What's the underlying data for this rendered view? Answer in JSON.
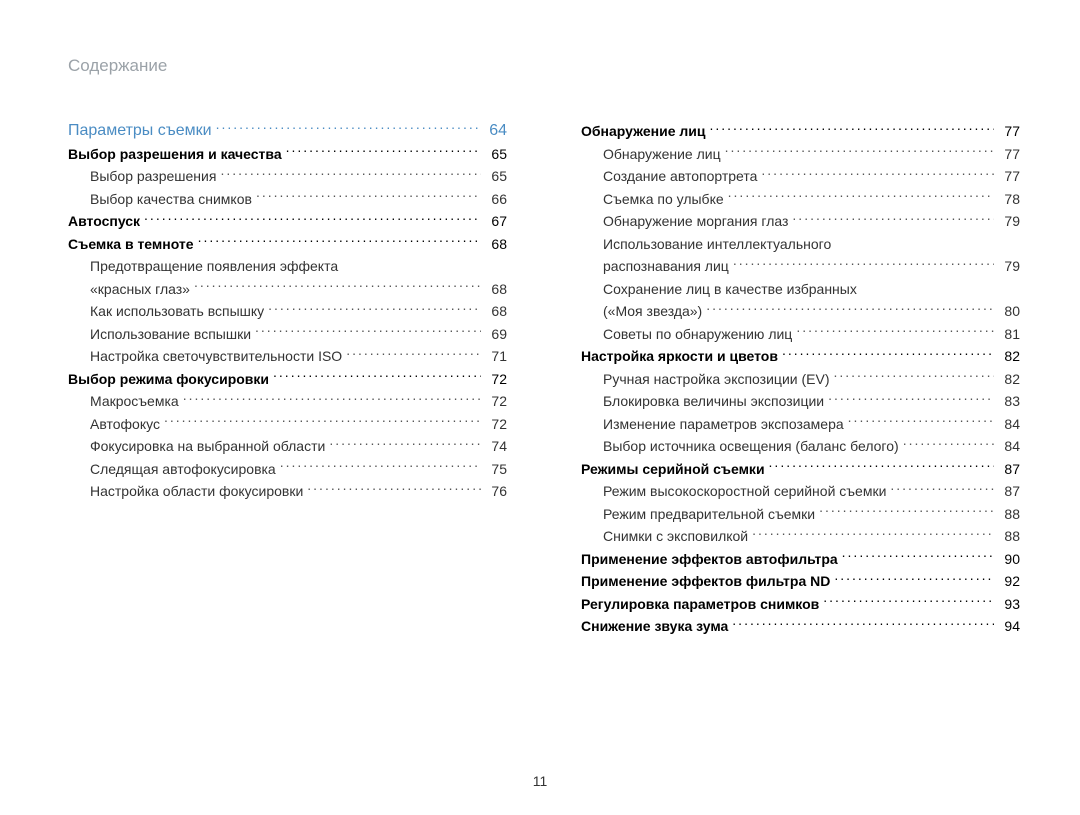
{
  "header": "Содержание",
  "page_number": "11",
  "left_col": [
    {
      "type": "chapter",
      "label": "Параметры съемки",
      "page": "64"
    },
    {
      "type": "section",
      "label": "Выбор разрешения и качества",
      "page": "65"
    },
    {
      "type": "item",
      "label": "Выбор разрешения",
      "page": "65"
    },
    {
      "type": "item",
      "label": "Выбор качества снимков",
      "page": "66"
    },
    {
      "type": "section",
      "label": "Автоспуск",
      "page": "67"
    },
    {
      "type": "section",
      "label": "Съемка в темноте",
      "page": "68"
    },
    {
      "type": "item-noline",
      "label": "Предотвращение появления эффекта"
    },
    {
      "type": "item-continue",
      "label": "«красных глаз»",
      "page": "68"
    },
    {
      "type": "item",
      "label": "Как использовать вспышку",
      "page": "68"
    },
    {
      "type": "item",
      "label": "Использование вспышки",
      "page": "69"
    },
    {
      "type": "item",
      "label": "Настройка светочувствительности ISO",
      "page": "71"
    },
    {
      "type": "section",
      "label": "Выбор режима фокусировки",
      "page": "72"
    },
    {
      "type": "item",
      "label": "Макросъемка",
      "page": "72"
    },
    {
      "type": "item",
      "label": "Автофокус",
      "page": "72"
    },
    {
      "type": "item",
      "label": "Фокусировка на выбранной области",
      "page": "74"
    },
    {
      "type": "item",
      "label": "Следящая автофокусировка",
      "page": "75"
    },
    {
      "type": "item",
      "label": "Настройка области фокусировки",
      "page": "76"
    }
  ],
  "right_col": [
    {
      "type": "section",
      "label": "Обнаружение лиц",
      "page": "77"
    },
    {
      "type": "item",
      "label": "Обнаружение лиц",
      "page": "77"
    },
    {
      "type": "item",
      "label": "Создание автопортрета",
      "page": "77"
    },
    {
      "type": "item",
      "label": "Съемка по улыбке",
      "page": "78"
    },
    {
      "type": "item",
      "label": "Обнаружение моргания глаз",
      "page": "79"
    },
    {
      "type": "item-noline",
      "label": "Использование интеллектуального"
    },
    {
      "type": "item-continue",
      "label": "распознавания лиц",
      "page": "79"
    },
    {
      "type": "item-noline",
      "label": "Сохранение лиц в качестве избранных"
    },
    {
      "type": "item-continue",
      "label": "(«Моя звезда»)",
      "page": "80"
    },
    {
      "type": "item",
      "label": "Советы по обнаружению лиц",
      "page": "81"
    },
    {
      "type": "section",
      "label": "Настройка яркости и цветов",
      "page": "82"
    },
    {
      "type": "item",
      "label": "Ручная настройка экспозиции (EV)",
      "page": "82"
    },
    {
      "type": "item",
      "label": "Блокировка величины экспозиции",
      "page": "83"
    },
    {
      "type": "item",
      "label": "Изменение параметров экспозамера",
      "page": "84"
    },
    {
      "type": "item",
      "label": "Выбор источника освещения (баланс белого)",
      "page": "84"
    },
    {
      "type": "section",
      "label": "Режимы серийной съемки",
      "page": "87"
    },
    {
      "type": "item",
      "label": "Режим высокоскоростной серийной съемки",
      "page": "87"
    },
    {
      "type": "item",
      "label": "Режим предварительной съемки",
      "page": "88"
    },
    {
      "type": "item",
      "label": "Снимки с эксповилкой",
      "page": "88"
    },
    {
      "type": "section",
      "label": "Применение эффектов автофильтра",
      "page": "90"
    },
    {
      "type": "section",
      "label": "Применение эффектов фильтра ND",
      "page": "92"
    },
    {
      "type": "section",
      "label": "Регулировка параметров снимков",
      "page": "93"
    },
    {
      "type": "section",
      "label": "Снижение звука зума",
      "page": "94"
    }
  ]
}
